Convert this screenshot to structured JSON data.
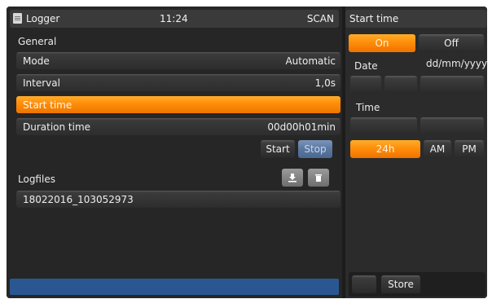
{
  "titlebar": {
    "app_name": "Logger",
    "icon": "document-icon",
    "clock": "11:24",
    "mode": "SCAN"
  },
  "general": {
    "section_label": "General",
    "rows": [
      {
        "label": "Mode",
        "value": "Automatic"
      },
      {
        "label": "Interval",
        "value": "1,0s"
      },
      {
        "label": "Start time",
        "value": ""
      },
      {
        "label": "Duration time",
        "value": "00d00h01min"
      }
    ],
    "start_button": "Start",
    "stop_button": "Stop"
  },
  "logfiles": {
    "section_label": "Logfiles",
    "download_icon": "download-icon",
    "trash_icon": "trash-icon",
    "items": [
      "18022016_103052973"
    ]
  },
  "start_time_panel": {
    "title": "Start time",
    "on_label": "On",
    "off_label": "Off",
    "date_label": "Date",
    "date_format": "dd/mm/yyyy",
    "time_label": "Time",
    "h24_label": "24h",
    "am_label": "AM",
    "pm_label": "PM",
    "store_label": "Store"
  },
  "colors": {
    "accent": "#ff8c00",
    "status_bar": "#2a5792",
    "selected_blue": "#5a77a0"
  }
}
